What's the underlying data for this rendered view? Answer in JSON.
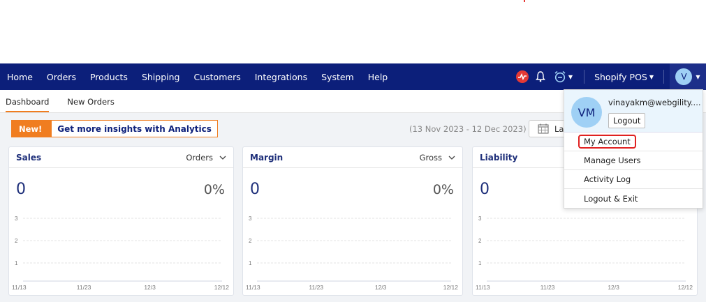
{
  "nav": {
    "items": [
      "Home",
      "Orders",
      "Products",
      "Shipping",
      "Customers",
      "Integrations",
      "System",
      "Help"
    ],
    "store": "Shopify POS",
    "avatar_initial": "V"
  },
  "tabs": [
    "Dashboard",
    "New Orders"
  ],
  "analytics": {
    "badge": "New!",
    "text": "Get more insights with Analytics"
  },
  "date_range": "(13 Nov 2023 - 12 Dec 2023)",
  "date_button": "La",
  "cards": [
    {
      "title": "Sales",
      "selector": "Orders",
      "value": "0",
      "percent": "0%"
    },
    {
      "title": "Margin",
      "selector": "Gross",
      "value": "0",
      "percent": "0%"
    },
    {
      "title": "Liability",
      "selector": "",
      "value": "0",
      "percent": ""
    }
  ],
  "chart_common": {
    "y_ticks": [
      "3",
      "2",
      "1"
    ],
    "x_ticks": [
      "11/13",
      "11/23",
      "12/3",
      "12/12"
    ]
  },
  "account_menu": {
    "initials": "VM",
    "email": "vinayakm@webgility....",
    "logout_button": "Logout",
    "items": [
      "My Account",
      "Manage Users",
      "Activity Log",
      "Logout & Exit"
    ]
  },
  "colors": {
    "navbar": "#0c1f7a",
    "accent": "#f07d20",
    "highlight": "#e02020"
  }
}
